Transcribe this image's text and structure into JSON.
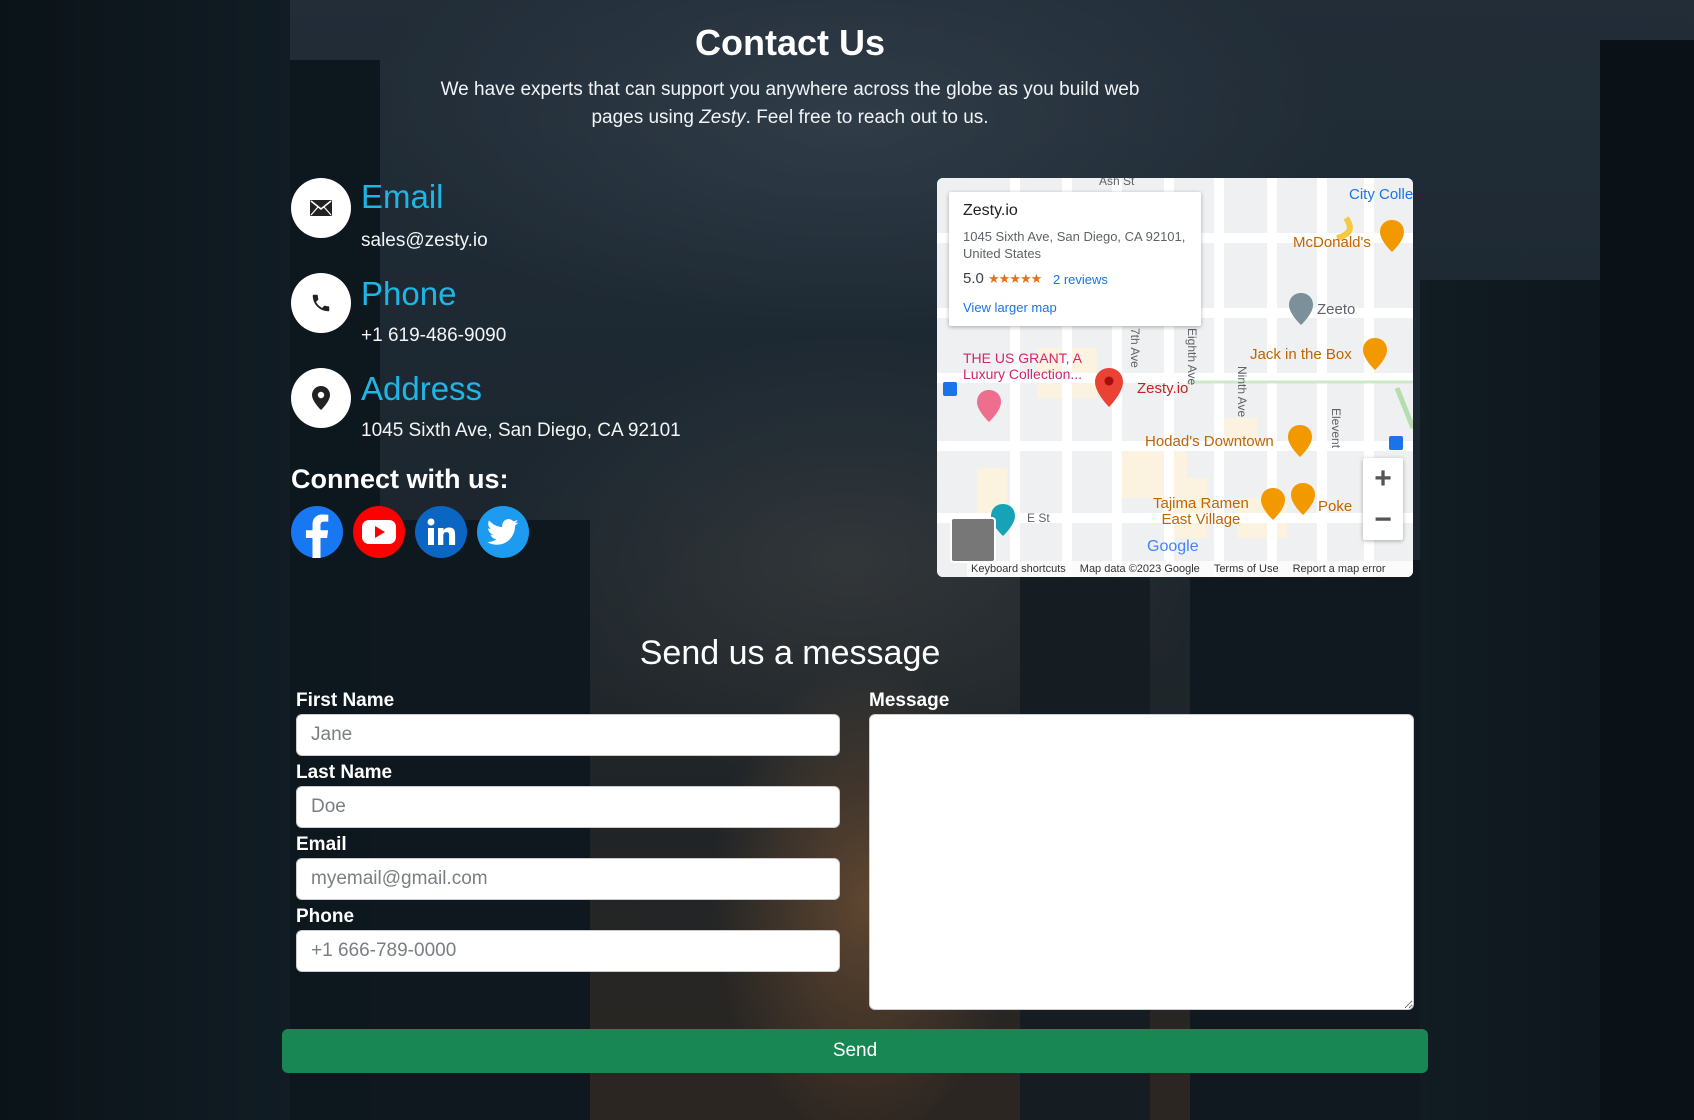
{
  "header": {
    "title": "Contact Us",
    "subtitle_pre": "We have experts that can support you anywhere across the globe as you build web pages using ",
    "subtitle_brand": "Zesty",
    "subtitle_post": ". Feel free to reach out to us."
  },
  "contact": {
    "email": {
      "label": "Email",
      "value": "sales@zesty.io",
      "icon": "envelope-icon"
    },
    "phone": {
      "label": "Phone",
      "value": "+1 619-486-9090",
      "icon": "phone-icon"
    },
    "address": {
      "label": "Address",
      "value": "1045 Sixth Ave, San Diego, CA 92101",
      "icon": "map-pin-icon"
    }
  },
  "connect": {
    "title": "Connect with us:",
    "socials": [
      "facebook-icon",
      "youtube-icon",
      "linkedin-icon",
      "twitter-icon"
    ]
  },
  "map": {
    "card": {
      "name": "Zesty.io",
      "address": "1045 Sixth Ave, San Diego, CA 92101, United States",
      "rating": "5.0",
      "stars": "★★★★★",
      "reviews": "2 reviews",
      "larger": "View larger map"
    },
    "labels": {
      "us_grant": "THE US GRANT, A",
      "us_grant2": "Luxury Collection...",
      "zesty": "Zesty.io",
      "hodads": "Hodad's Downtown",
      "jack": "Jack in the Box",
      "mcd": "McDonald's",
      "zeeto": "Zeeto",
      "tajima": "Tajima Ramen",
      "tajima2": "East Village",
      "poke": "Poke",
      "city": "City Colle",
      "est": "E St",
      "ash": "Ash St",
      "seventh": "7th Ave",
      "eighth": "Eighth Ave",
      "ninth": "Ninth Ave",
      "eleventh": "Elevent",
      "google": "Google"
    },
    "zoom_in": "+",
    "zoom_out": "−",
    "footer": [
      "Keyboard shortcuts",
      "Map data ©2023 Google",
      "Terms of Use",
      "Report a map error"
    ]
  },
  "form": {
    "title": "Send us a message",
    "first_name": {
      "label": "First Name",
      "placeholder": "Jane"
    },
    "last_name": {
      "label": "Last Name",
      "placeholder": "Doe"
    },
    "email": {
      "label": "Email",
      "placeholder": "myemail@gmail.com"
    },
    "phone": {
      "label": "Phone",
      "placeholder": "+1 666-789-0000"
    },
    "message": {
      "label": "Message"
    },
    "send": "Send"
  },
  "colors": {
    "accent": "#1fb6e6",
    "send": "#198754",
    "facebook": "#1877f2",
    "youtube": "#ff0000",
    "linkedin": "#0a66c2",
    "twitter": "#1d9bf0"
  }
}
